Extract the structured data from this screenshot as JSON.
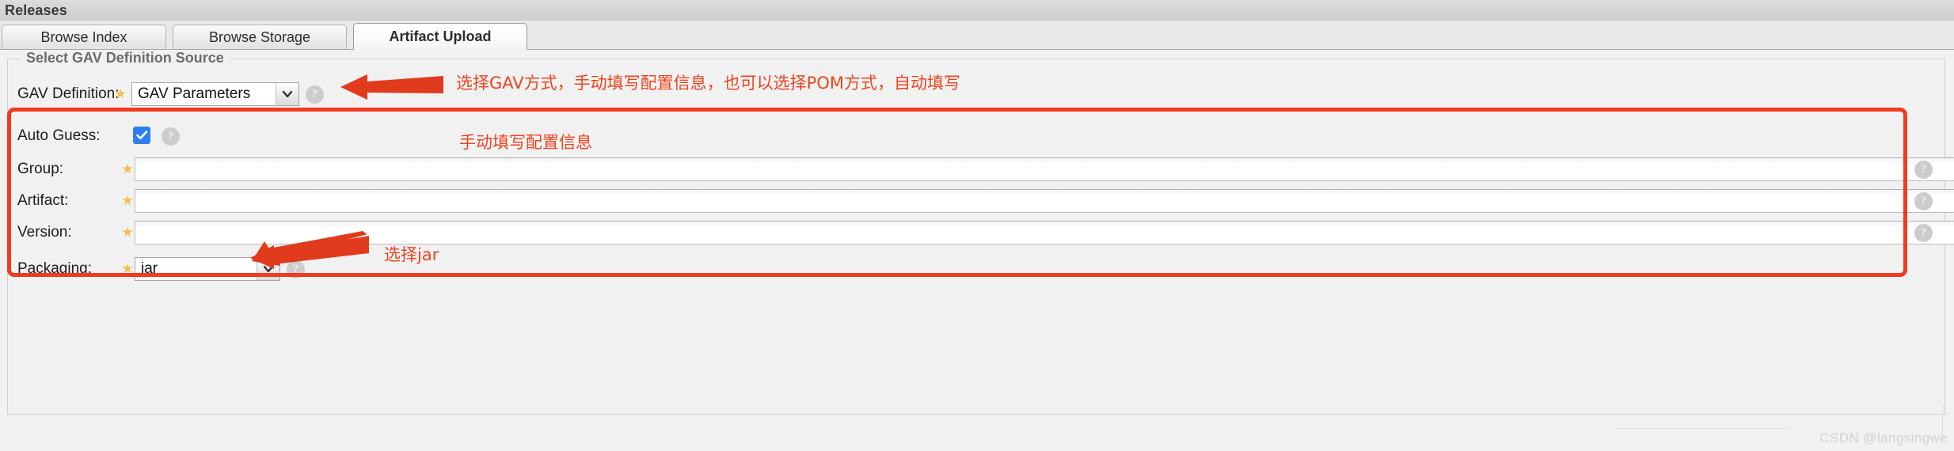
{
  "window": {
    "title": "Releases"
  },
  "tabs": [
    {
      "label": "Browse Index",
      "active": false
    },
    {
      "label": "Browse Storage",
      "active": false
    },
    {
      "label": "Artifact Upload",
      "active": true
    }
  ],
  "fieldset": {
    "legend": "Select GAV Definition Source"
  },
  "form": {
    "gav_definition": {
      "label": "GAV Definition:",
      "value": "GAV Parameters",
      "required_marker": "★",
      "help": "?"
    },
    "auto_guess": {
      "label": "Auto Guess:",
      "checked": true,
      "help": "?"
    },
    "group": {
      "label": "Group:",
      "value": "",
      "placeholder": "",
      "required_marker": "★",
      "help": "?"
    },
    "artifact": {
      "label": "Artifact:",
      "value": "",
      "placeholder": "",
      "required_marker": "★",
      "help": "?"
    },
    "version": {
      "label": "Version:",
      "value": "",
      "placeholder": "",
      "required_marker": "★",
      "help": "?"
    },
    "packaging": {
      "label": "Packaging:",
      "value": "jar",
      "required_marker": "★",
      "help": "?"
    }
  },
  "annotations": [
    {
      "id": "gav-mode",
      "text": "选择GAV方式，手动填写配置信息，也可以选择POM方式，自动填写"
    },
    {
      "id": "manual-fill",
      "text": "手动填写配置信息"
    },
    {
      "id": "select-jar",
      "text": "选择jar"
    }
  ],
  "colors": {
    "annotation_red": "#ec441f",
    "highlight_box": "#ef3b1f",
    "checkbox_blue": "#2f7ef0",
    "star_gold": "#f2c14a"
  },
  "watermark": {
    "text": "CSDN @langsingwe"
  }
}
